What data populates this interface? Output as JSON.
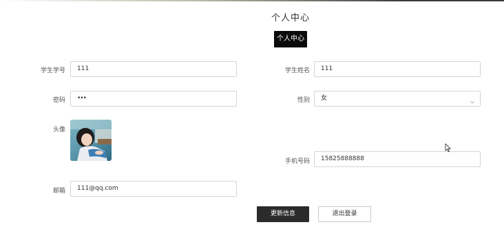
{
  "header": {
    "title": "个人中心",
    "tab_label": "个人中心"
  },
  "form": {
    "student_id": {
      "label": "学生学号",
      "value": "111"
    },
    "student_name": {
      "label": "学生姓名",
      "value": "111"
    },
    "password": {
      "label": "密码",
      "value": "•••"
    },
    "gender": {
      "label": "性别",
      "value": "女",
      "icon": "chevron-down-icon"
    },
    "avatar": {
      "label": "头像"
    },
    "phone": {
      "label": "手机号码",
      "value": "15825888888"
    },
    "email": {
      "label": "邮箱",
      "value": "111@qq.com"
    }
  },
  "actions": {
    "update_label": "更新信息",
    "logout_label": "退出登录"
  },
  "colors": {
    "primary_button": "#2b2b2b",
    "tab_badge": "#0b0b0b",
    "input_border": "#d4d4d4"
  }
}
